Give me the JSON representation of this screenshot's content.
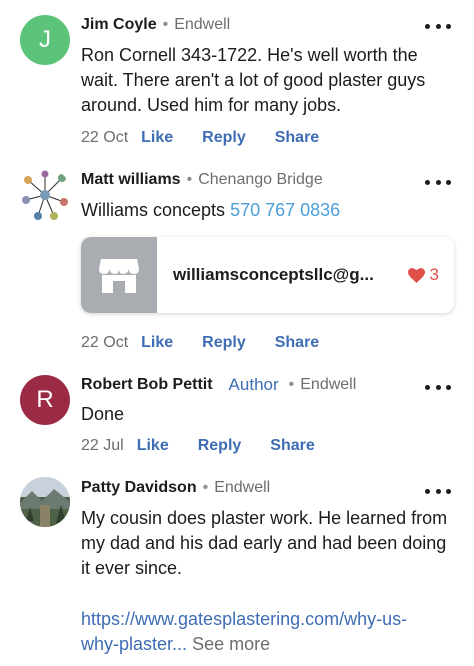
{
  "comments": [
    {
      "avatar_letter": "J",
      "avatar_color": "#5cc47a",
      "name": "Jim Coyle",
      "separator": "•",
      "location": "Endwell",
      "text": "Ron Cornell 343-1722. He's well worth the wait. There aren't a lot of good plaster guys around. Used him for many jobs.",
      "date": "22 Oct",
      "like": "Like",
      "reply": "Reply",
      "share": "Share"
    },
    {
      "avatar_icon": "sketch-drawing-avatar",
      "name": "Matt williams",
      "separator": "•",
      "location": "Chenango Bridge",
      "text": "Williams concepts",
      "phone": "570 767 0836",
      "card": {
        "icon": "storefront-icon",
        "title": "williamsconceptsllc@g...",
        "likes": "3"
      },
      "date": "22 Oct",
      "like": "Like",
      "reply": "Reply",
      "share": "Share"
    },
    {
      "avatar_letter": "R",
      "avatar_color": "#9b2a44",
      "name": "Robert Bob Pettit",
      "badge": "Author",
      "separator": "•",
      "location": "Endwell",
      "text": "Done",
      "date": "22 Jul",
      "like": "Like",
      "reply": "Reply",
      "share": "Share"
    },
    {
      "avatar_icon": "landscape-photo-avatar",
      "name": "Patty Davidson",
      "separator": "•",
      "location": "Endwell",
      "text": "My cousin does plaster work. He learned from my dad and his dad early and had been doing it ever since.",
      "url_line1": "https://www.gatesplastering.com/why-us-",
      "url_line2": "why-plaster...",
      "see_more": "See more"
    }
  ],
  "colors": {
    "link_blue": "#3e6db4",
    "phone_blue": "#4a9fd8",
    "heart_red": "#e0504a"
  }
}
